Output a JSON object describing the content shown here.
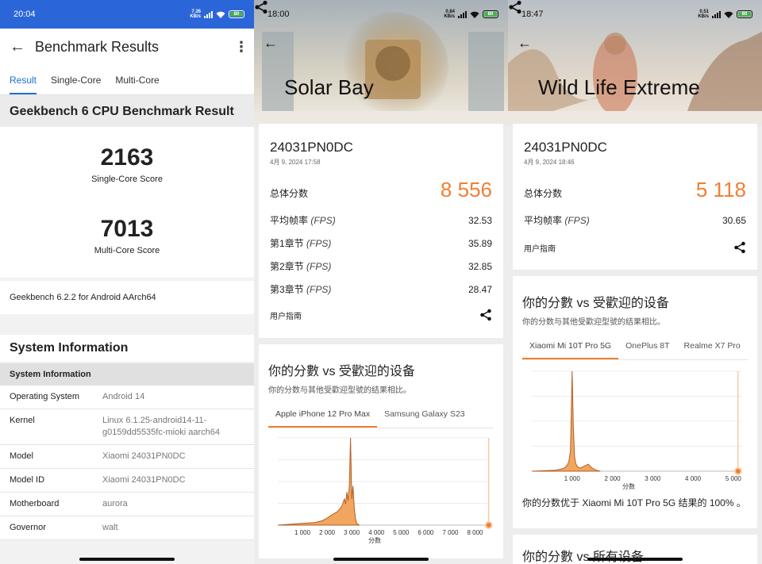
{
  "panel1": {
    "status": {
      "time": "20:04",
      "net_rate": "7.36",
      "net_unit": "KB/s",
      "battery": "80"
    },
    "appbar": {
      "title": "Benchmark Results"
    },
    "tabs": [
      {
        "label": "Result"
      },
      {
        "label": "Single-Core"
      },
      {
        "label": "Multi-Core"
      }
    ],
    "result_header": "Geekbench 6 CPU Benchmark Result",
    "single_score": "2163",
    "single_label": "Single-Core Score",
    "multi_score": "7013",
    "multi_label": "Multi-Core Score",
    "version": "Geekbench 6.2.2 for Android AArch64",
    "system_title": "System Information",
    "system_sub": "System Information",
    "system_rows": [
      {
        "key": "Operating System",
        "value": "Android 14"
      },
      {
        "key": "Kernel",
        "value": "Linux 6.1.25-android14-11-g0159dd5535fc-mioki aarch64"
      },
      {
        "key": "Model",
        "value": "Xiaomi 24031PN0DC"
      },
      {
        "key": "Model ID",
        "value": "Xiaomi 24031PN0DC"
      },
      {
        "key": "Motherboard",
        "value": "aurora"
      },
      {
        "key": "Governor",
        "value": "walt"
      }
    ]
  },
  "panel2": {
    "status": {
      "time": "18:00",
      "net_rate": "0.84",
      "net_unit": "KB/s",
      "battery": "80"
    },
    "hero_title": "Solar Bay",
    "device": "24031PN0DC",
    "date": "4月 9, 2024 17:58",
    "total_label": "总体分数",
    "total_score": "8 556",
    "metrics": [
      {
        "label": "平均帧率",
        "unit": "(FPS)",
        "value": "32.53"
      },
      {
        "label": "第1章节",
        "unit": "(FPS)",
        "value": "35.89"
      },
      {
        "label": "第2章节",
        "unit": "(FPS)",
        "value": "32.85"
      },
      {
        "label": "第3章节",
        "unit": "(FPS)",
        "value": "28.47"
      }
    ],
    "guide": "用户指南",
    "compare_title": "你的分數 vs 受歡迎的设备",
    "compare_sub": "你的分数与其他受歡迎型號的结果相比。",
    "compare_tabs": [
      "Apple iPhone 12 Pro Max",
      "Samsung Galaxy S23"
    ],
    "chart_data": {
      "type": "area",
      "xlabel": "分数",
      "xlim": [
        0,
        8500
      ],
      "x_ticks": [
        "1 000",
        "2 000",
        "3 000",
        "4 000",
        "5 000",
        "6 000",
        "7 000",
        "8 000"
      ],
      "x_tick_values": [
        1000,
        2000,
        3000,
        4000,
        5000,
        6000,
        7000,
        8000
      ],
      "x": [
        0,
        500,
        1000,
        1500,
        1800,
        2000,
        2200,
        2400,
        2500,
        2600,
        2700,
        2750,
        2800,
        2850,
        2900,
        2950,
        3000,
        3050,
        3100,
        3150,
        3200,
        3300
      ],
      "values": [
        0,
        1,
        2,
        3,
        5,
        8,
        12,
        15,
        18,
        22,
        30,
        24,
        38,
        28,
        45,
        100,
        30,
        45,
        20,
        8,
        2,
        0
      ],
      "your_score": 8556
    }
  },
  "panel3": {
    "status": {
      "time": "18:47",
      "net_rate": "0.51",
      "net_unit": "KB/s",
      "battery": "80"
    },
    "hero_title": "Wild Life Extreme",
    "device": "24031PN0DC",
    "date": "4月 9, 2024 18:46",
    "total_label": "总体分数",
    "total_score": "5 118",
    "metrics": [
      {
        "label": "平均帧率",
        "unit": "(FPS)",
        "value": "30.65"
      }
    ],
    "guide": "用户指南",
    "compare_title": "你的分數 vs 受歡迎的设备",
    "compare_sub": "你的分数与其他受歡迎型號的结果相比。",
    "compare_tabs": [
      "Xiaomi Mi 10T Pro 5G",
      "OnePlus 8T",
      "Realme X7 Pro"
    ],
    "chart_data": {
      "type": "area",
      "xlabel": "分数",
      "xlim": [
        0,
        5200
      ],
      "x_ticks": [
        "1 000",
        "2 000",
        "3 000",
        "4 000",
        "5 000"
      ],
      "x_tick_values": [
        1000,
        2000,
        3000,
        4000,
        5000
      ],
      "x": [
        0,
        600,
        800,
        880,
        920,
        960,
        1000,
        1030,
        1060,
        1090,
        1120,
        1150,
        1200,
        1300,
        1400,
        1500,
        1600,
        1700
      ],
      "values": [
        0,
        1,
        3,
        6,
        10,
        20,
        100,
        45,
        15,
        8,
        5,
        4,
        3,
        5,
        7,
        3,
        1,
        0
      ],
      "your_score": 5118
    },
    "result_note": "你的分数优于 Xiaomi Mi 10T Pro 5G 结果的 100% 。",
    "next_section_peek": "你的分數 vs 所有设备"
  }
}
